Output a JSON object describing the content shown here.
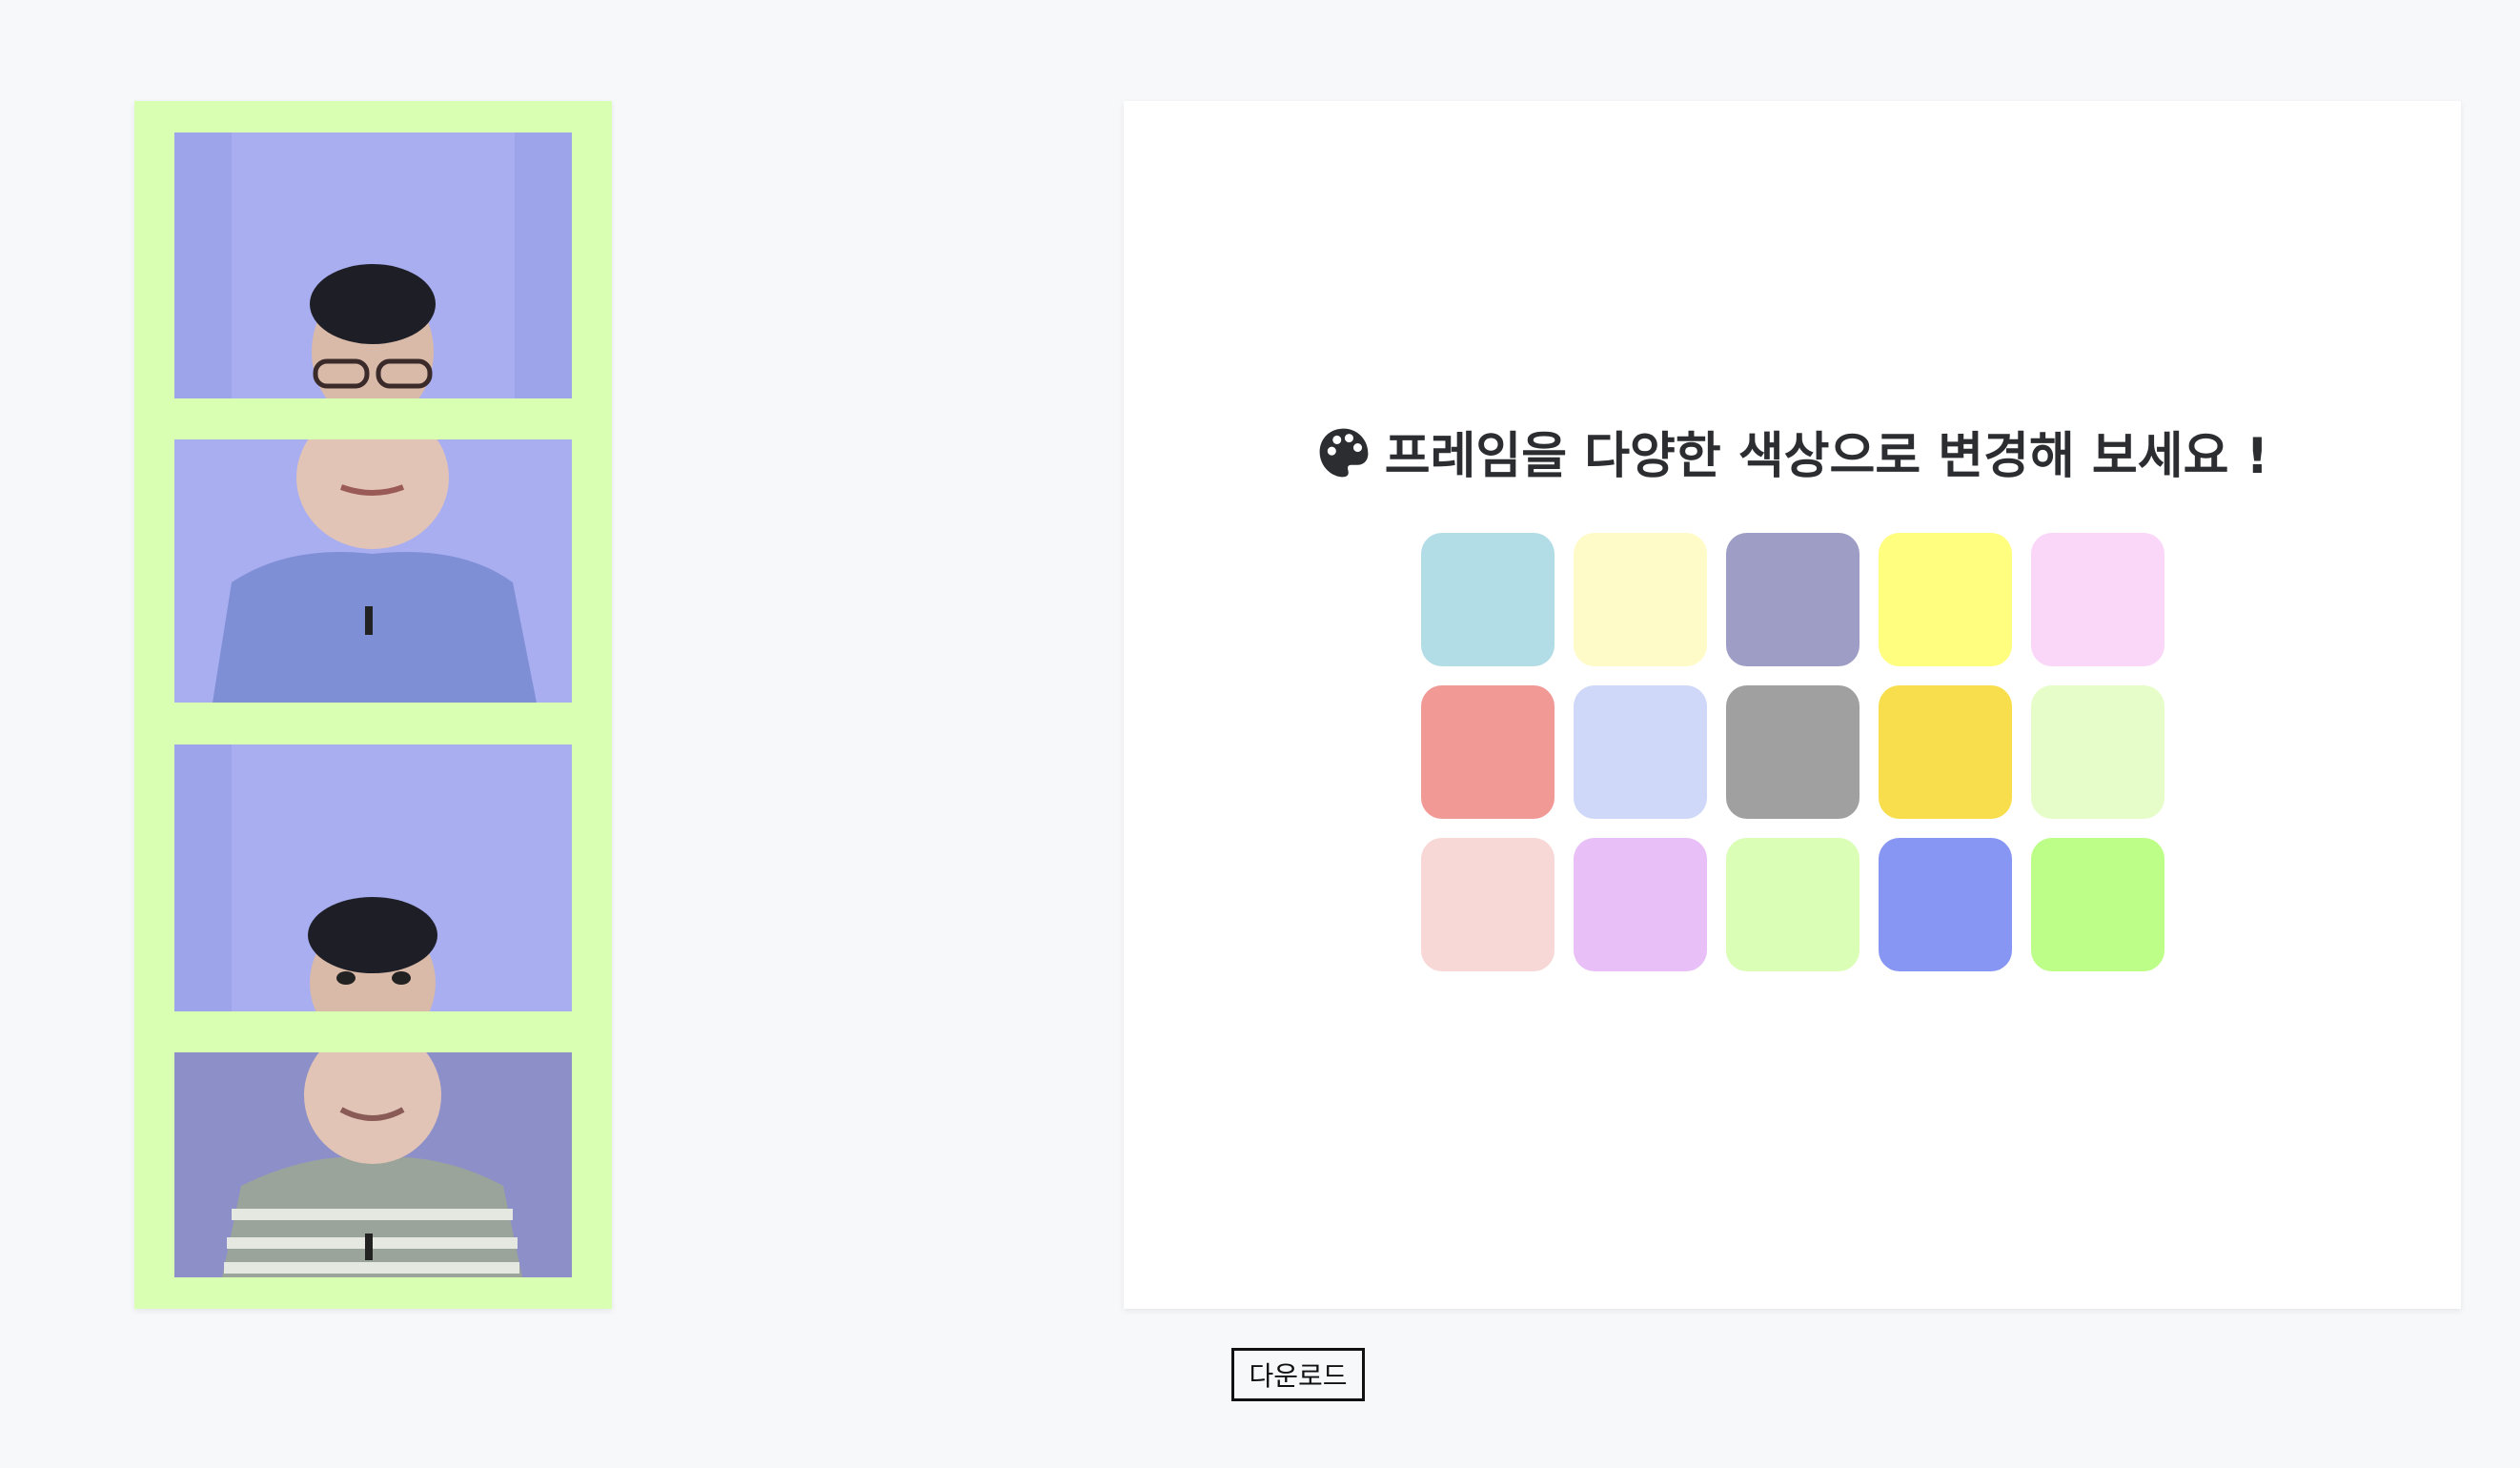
{
  "frame": {
    "color": "#d9ffb3",
    "photos": [
      {
        "scene": "top-of-head-with-glasses",
        "icon": "person-photo"
      },
      {
        "scene": "mouth-and-shirt",
        "icon": "person-photo"
      },
      {
        "scene": "eyes-peeking",
        "icon": "person-photo"
      },
      {
        "scene": "smile-striped-shirt",
        "icon": "person-photo"
      }
    ]
  },
  "panel": {
    "heading": "프레임을 다양한 색상으로 변경해 보세요 !",
    "heading_icon": "palette-icon",
    "swatches": [
      "#b3dde6",
      "#fffbc8",
      "#9d9dc6",
      "#fffe7e",
      "#fad7f9",
      "#f09995",
      "#cfd8f8",
      "#a0a0a0",
      "#f8de4c",
      "#e6fdc9",
      "#f8d8d6",
      "#e8c0f7",
      "#dafeb5",
      "#8896f3",
      "#bdfe88"
    ]
  },
  "download_label": "다운로드"
}
